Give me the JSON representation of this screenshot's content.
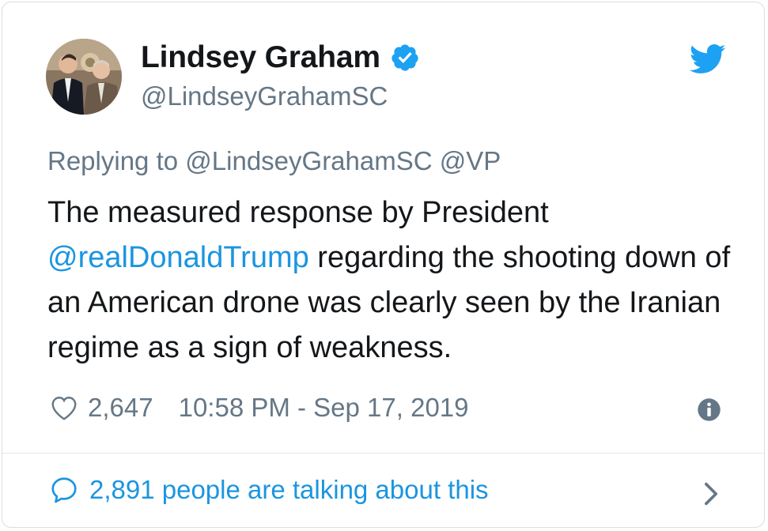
{
  "author": {
    "display_name": "Lindsey Graham",
    "handle": "@LindseyGrahamSC",
    "verified_icon": "verified-badge-icon",
    "avatar": "profile-photo"
  },
  "brand_icon": "twitter-bird-icon",
  "reply": {
    "prefix": "Replying to",
    "mention_1": "@LindseyGrahamSC",
    "mention_2": "@VP"
  },
  "tweet": {
    "part_1": "The measured response by President ",
    "mention": "@realDonaldTrump",
    "part_2": " regarding the shooting down of an American drone was clearly seen by the Iranian regime as a sign of weakness."
  },
  "meta": {
    "likes": "2,647",
    "timestamp": "10:58 PM - Sep 17, 2019",
    "heart_icon": "heart-icon",
    "info_icon": "info-icon"
  },
  "conversation": {
    "label": "2,891 people are talking about this",
    "bubble_icon": "speech-bubble-icon",
    "chevron_icon": "chevron-right-icon"
  },
  "colors": {
    "link": "#1b95e0",
    "text": "#14171a",
    "muted": "#657786",
    "border": "#d9dfe3"
  }
}
